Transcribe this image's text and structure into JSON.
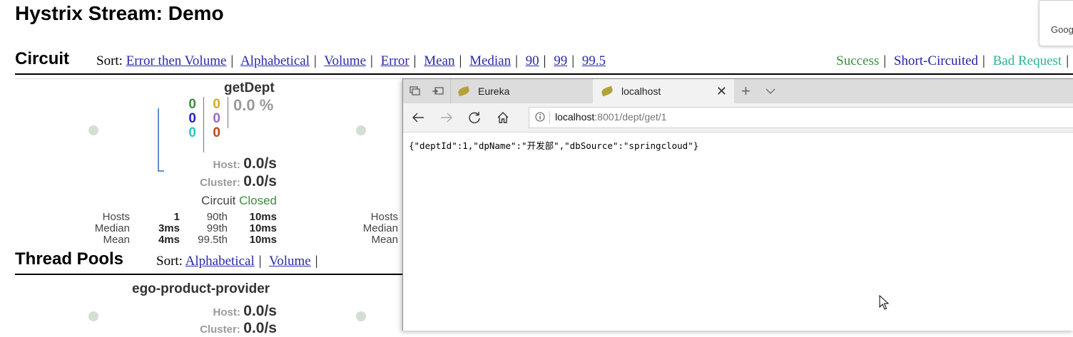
{
  "page": {
    "title": "Hystrix Stream: Demo"
  },
  "circuit_section": {
    "title": "Circuit",
    "sort_label": "Sort:",
    "sort_options": [
      "Error then Volume",
      "Alphabetical",
      "Volume",
      "Error",
      "Mean",
      "Median",
      "90",
      "99",
      "99.5"
    ],
    "legend": [
      {
        "label": "Success",
        "color": "#3d8c3d"
      },
      {
        "label": "Short-Circuited",
        "color": "#2222a6"
      },
      {
        "label": "Bad Request",
        "color": "#2ab39a"
      }
    ],
    "legend_sep": "|"
  },
  "circuit": {
    "name": "getDept",
    "counts_col1": [
      {
        "value": "0",
        "color": "#3d8c3d"
      },
      {
        "value": "0",
        "color": "#2222c9"
      },
      {
        "value": "0",
        "color": "#2fc2c2"
      }
    ],
    "counts_col2": [
      {
        "value": "0",
        "color": "#d4a82a"
      },
      {
        "value": "0",
        "color": "#9a6ac8"
      },
      {
        "value": "0",
        "color": "#c0451f"
      }
    ],
    "error_pct": "0.0 %",
    "host_label": "Host:",
    "host_rate": "0.0/s",
    "cluster_label": "Cluster:",
    "cluster_rate": "0.0/s",
    "circuit_label": "Circuit",
    "circuit_status": "Closed",
    "circuit_status_color": "#3d8c3d",
    "stats": {
      "row1": {
        "l1": "Hosts",
        "v1": "1",
        "l2": "90th",
        "v2": "10ms"
      },
      "row2": {
        "l1": "Median",
        "v1": "3ms",
        "l2": "99th",
        "v2": "10ms"
      },
      "row3": {
        "l1": "Mean",
        "v1": "4ms",
        "l2": "99.5th",
        "v2": "10ms"
      }
    }
  },
  "circuit2_partial": {
    "hosts": "Hosts",
    "median": "Median",
    "mean": "Mean"
  },
  "threadpool_section": {
    "title": "Thread Pools",
    "sort_label": "Sort:",
    "sort_options": [
      "Alphabetical",
      "Volume"
    ]
  },
  "threadpool": {
    "name": "ego-product-provider",
    "host_label": "Host:",
    "host_rate": "0.0/s",
    "cluster_label": "Cluster:",
    "cluster_rate": "0.0/s"
  },
  "browser": {
    "tabs": [
      {
        "label": "Eureka"
      },
      {
        "label": "localhost"
      }
    ],
    "url_host": "localhost",
    "url_rest": ":8001/dept/get/1",
    "body_text": "{\"deptId\":1,\"dpName\":\"开发部\",\"dbSource\":\"springcloud\"}"
  },
  "popup": {
    "text": "Goog"
  }
}
